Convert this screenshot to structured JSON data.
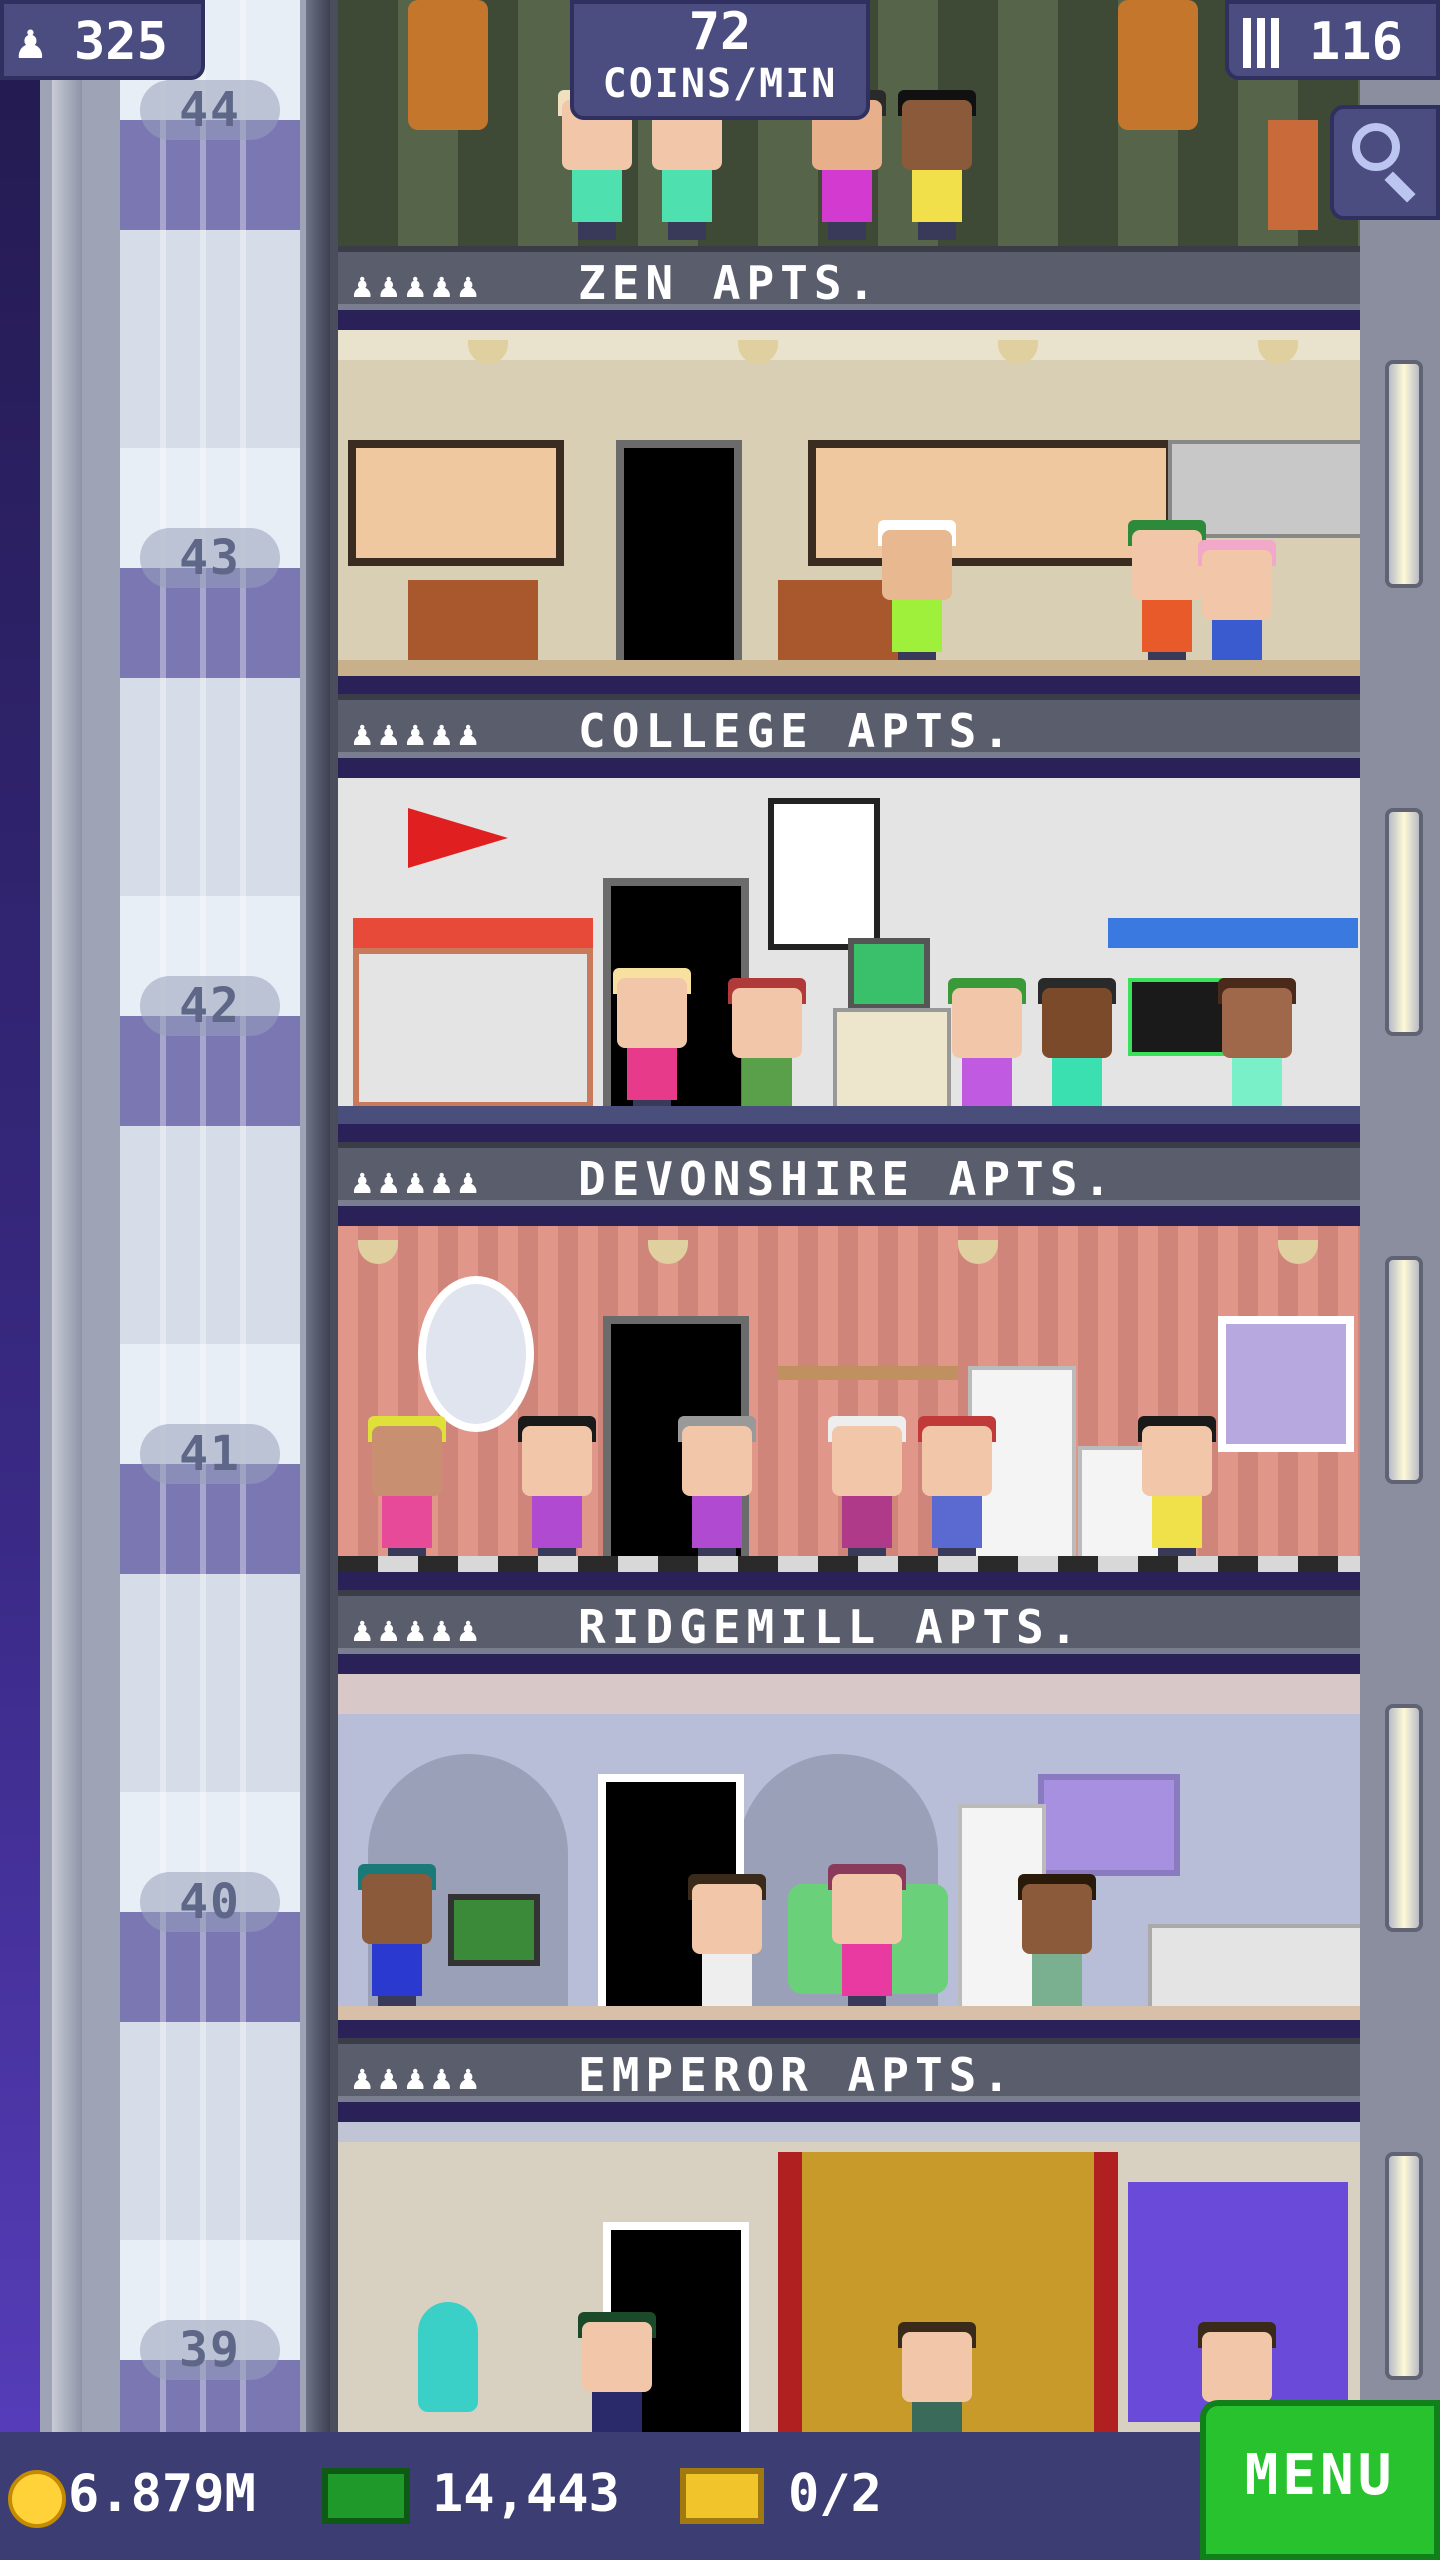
{
  "hud": {
    "population": "325",
    "coins_rate_value": "72",
    "coins_rate_unit": "COINS/MIN",
    "floors_count": "116",
    "coins": "6.879M",
    "bux": "14,443",
    "vip": "0/2",
    "menu_label": "MENU"
  },
  "floors": [
    {
      "number": "44",
      "name": "ZEN APTS.",
      "pips": "♟♟♟♟♟"
    },
    {
      "number": "43",
      "name": "COLLEGE APTS.",
      "pips": "♟♟♟♟♟"
    },
    {
      "number": "42",
      "name": "DEVONSHIRE APTS.",
      "pips": "♟♟♟♟♟"
    },
    {
      "number": "41",
      "name": "RIDGEMILL APTS.",
      "pips": "♟♟♟♟♟"
    },
    {
      "number": "40",
      "name": "EMPEROR APTS.",
      "pips": "♟♟♟♟♟"
    },
    {
      "number": "39",
      "name": "",
      "pips": ""
    }
  ],
  "colors": {
    "menu_green": "#27c22d",
    "hud_purple": "#4b4d80",
    "coin_gold": "#ffd23a"
  }
}
